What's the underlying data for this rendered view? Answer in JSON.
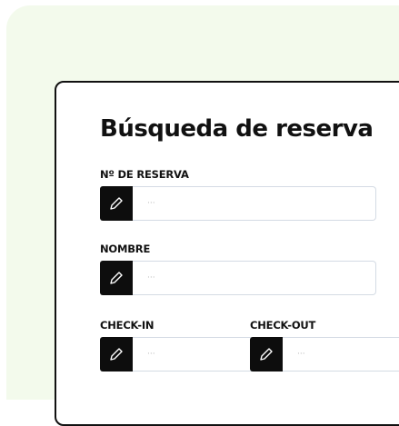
{
  "form": {
    "title": "Búsqueda de reserva",
    "fields": {
      "reservation_number": {
        "label": "Nº DE RESERVA",
        "placeholder": "···",
        "icon": "pencil-icon"
      },
      "name": {
        "label": "NOMBRE",
        "placeholder": "···",
        "icon": "pencil-icon"
      },
      "check_in": {
        "label": "CHECK-IN",
        "placeholder": "···",
        "icon": "pencil-icon"
      },
      "check_out": {
        "label": "CHECK-OUT",
        "placeholder": "···",
        "icon": "pencil-icon"
      }
    }
  },
  "colors": {
    "background_tint": "#f3faec",
    "card_border": "#111111",
    "icon_box": "#0d0d0d",
    "input_border": "#d4dbe4"
  }
}
